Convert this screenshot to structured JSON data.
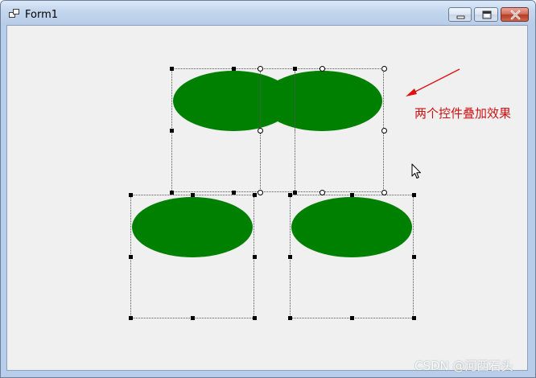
{
  "window": {
    "title": "Form1",
    "icon": "form-app-icon",
    "controls": [
      "minimize-icon",
      "maximize-icon",
      "close-icon"
    ]
  },
  "annotation": {
    "text": "两个控件叠加效果",
    "color": "#cc1111"
  },
  "watermark": {
    "text": "CSDN @河西石头"
  },
  "ellipse_controls": {
    "count": 4,
    "fill_color": "#008000"
  },
  "colors": {
    "client_bg": "#f0f0f0",
    "titlebar": "#c3d6ee",
    "close_button": "#c94b35"
  }
}
